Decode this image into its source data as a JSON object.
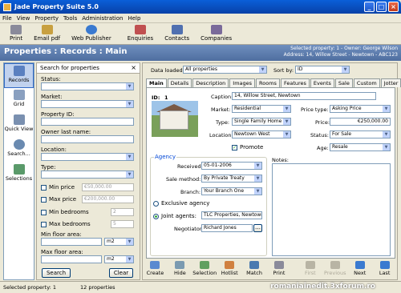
{
  "window": {
    "title": "Jade Property Suite 5.0"
  },
  "menu": [
    "File",
    "View",
    "Property",
    "Tools",
    "Administration",
    "Help"
  ],
  "toolbar": [
    {
      "label": "Print",
      "icon": "printer-icon",
      "color": "#8a8a9a"
    },
    {
      "label": "Email pdf",
      "icon": "email-pdf-icon",
      "color": "#c8a040"
    },
    {
      "label": "Web Publisher",
      "icon": "globe-icon",
      "color": "#3a7ad0"
    },
    {
      "label": "Enquiries",
      "icon": "enquiries-icon",
      "color": "#c05050"
    },
    {
      "label": "Contacts",
      "icon": "contacts-icon",
      "color": "#5070b0"
    },
    {
      "label": "Companies",
      "icon": "companies-icon",
      "color": "#7a6a9a"
    }
  ],
  "header": {
    "title": "Properties : Records : Main",
    "selected": "Selected property: 1 - Owner: George Wilson",
    "address": "Address: 14, Willow Street - Newtown - ABC123"
  },
  "leftnav": [
    {
      "label": "Records",
      "icon": "records-icon"
    },
    {
      "label": "Grid",
      "icon": "grid-icon"
    },
    {
      "label": "Quick View",
      "icon": "quick-view-icon"
    },
    {
      "label": "Search...",
      "icon": "search-icon"
    },
    {
      "label": "Selections",
      "icon": "selections-icon"
    }
  ],
  "search": {
    "title": "Search for properties",
    "status": "Status:",
    "market": "Market:",
    "property_id": "Property ID:",
    "owner": "Owner last name:",
    "location": "Location:",
    "type": "Type:",
    "min_price": "Min price",
    "min_price_ph": "€50,000.00",
    "max_price": "Max price",
    "max_price_ph": "€200,000.00",
    "min_bed": "Min bedrooms",
    "min_bed_v": "2",
    "max_bed": "Max bedrooms",
    "max_bed_v": "5",
    "min_floor": "Min floor area:",
    "max_floor": "Max floor area:",
    "unit": "m2",
    "search_btn": "Search",
    "clear_btn": "Clear"
  },
  "main": {
    "data_loaded_label": "Data loaded:",
    "data_loaded": "All properties",
    "sort_label": "Sort by:",
    "sort": "ID",
    "tabs": [
      "Main",
      "Details",
      "Description",
      "Images",
      "Rooms",
      "Features",
      "Events",
      "Sale",
      "Custom",
      "Jotter"
    ],
    "id_label": "ID:",
    "id": "1",
    "caption_label": "Caption:",
    "caption": "14, Willow Street, Newtown",
    "market_label": "Market:",
    "market": "Residential",
    "type_label": "Type:",
    "type": "Single Family Home",
    "location_label": "Location:",
    "location": "Newtown West",
    "promote": "Promote",
    "price_type_label": "Price type:",
    "price_type": "Asking Price",
    "price_label": "Price:",
    "price": "€250,000.00",
    "status_label": "Status:",
    "status": "For Sale",
    "age_label": "Age:",
    "age": "Resale",
    "agency_legend": "Agency",
    "received_label": "Received:",
    "received": "05-01-2006",
    "sale_method_label": "Sale method:",
    "sale_method": "By Private Treaty",
    "branch_label": "Branch:",
    "branch": "Your Branch One",
    "exclusive": "Exclusive agency",
    "joint": "Joint agents:",
    "joint_value": "TLC Properties, Newtown",
    "negotiator_label": "Negotiator:",
    "negotiator": "Richard Jones",
    "notes_label": "Notes:"
  },
  "bottom": [
    {
      "label": "Create",
      "icon": "create-icon",
      "color": "#5a8ad0"
    },
    {
      "label": "Hide",
      "icon": "hide-icon",
      "color": "#7a9ab0"
    },
    {
      "label": "Selection",
      "icon": "selection-icon",
      "color": "#60a060"
    },
    {
      "label": "Hotlist",
      "icon": "hotlist-icon",
      "color": "#d08040"
    },
    {
      "label": "Match",
      "icon": "match-icon",
      "color": "#4a7ab0"
    },
    {
      "label": "Print",
      "icon": "printer-icon",
      "color": "#8a8a9a"
    },
    {
      "label": "First",
      "icon": "first-icon",
      "color": "#b8b4a4"
    },
    {
      "label": "Previous",
      "icon": "previous-icon",
      "color": "#b8b4a4"
    },
    {
      "label": "Next",
      "icon": "next-icon",
      "color": "#3a7ad0"
    },
    {
      "label": "Last",
      "icon": "last-icon",
      "color": "#3a7ad0"
    }
  ],
  "status": {
    "selected": "Selected property: 1",
    "count": "12 properties"
  },
  "watermark": "romaniainedit.3xforum.ro"
}
